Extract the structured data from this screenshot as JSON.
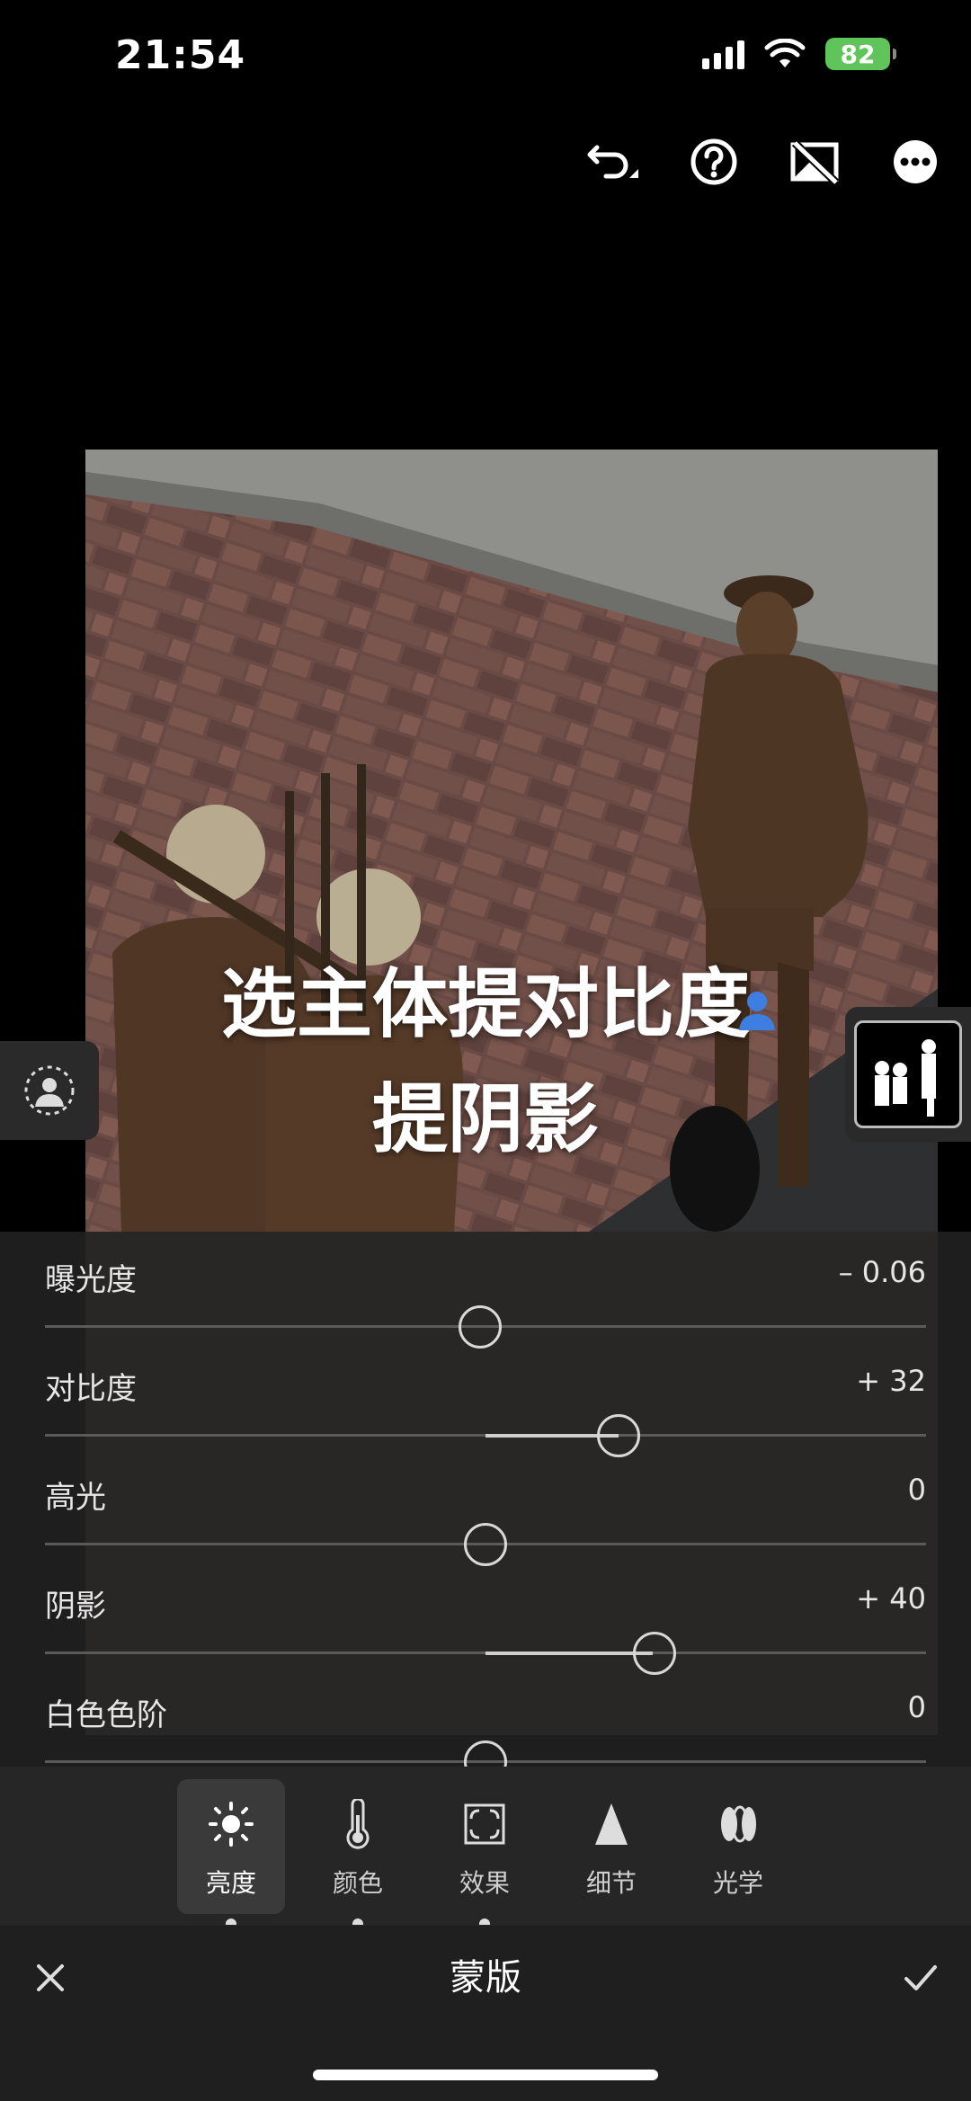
{
  "status_bar": {
    "time": "21:54",
    "battery": "82"
  },
  "caption": {
    "line1": "选主体提对比度",
    "line2": "提阴影"
  },
  "adjustments": [
    {
      "label": "曝光度",
      "value": "– 0.06",
      "level": -0.06
    },
    {
      "label": "对比度",
      "value": "+ 32",
      "level": 32
    },
    {
      "label": "高光",
      "value": "0",
      "level": 0
    },
    {
      "label": "阴影",
      "value": "+ 40",
      "level": 40
    },
    {
      "label": "白色色阶",
      "value": "0",
      "level": 0
    }
  ],
  "tabs": [
    {
      "label": "亮度",
      "icon": "sun-icon",
      "active": true
    },
    {
      "label": "颜色",
      "icon": "thermometer-icon",
      "active": false
    },
    {
      "label": "效果",
      "icon": "vignette-icon",
      "active": false
    },
    {
      "label": "细节",
      "icon": "triangle-icon",
      "active": false
    },
    {
      "label": "光学",
      "icon": "lens-icon",
      "active": false
    }
  ],
  "bottom_bar": {
    "title": "蒙版"
  }
}
